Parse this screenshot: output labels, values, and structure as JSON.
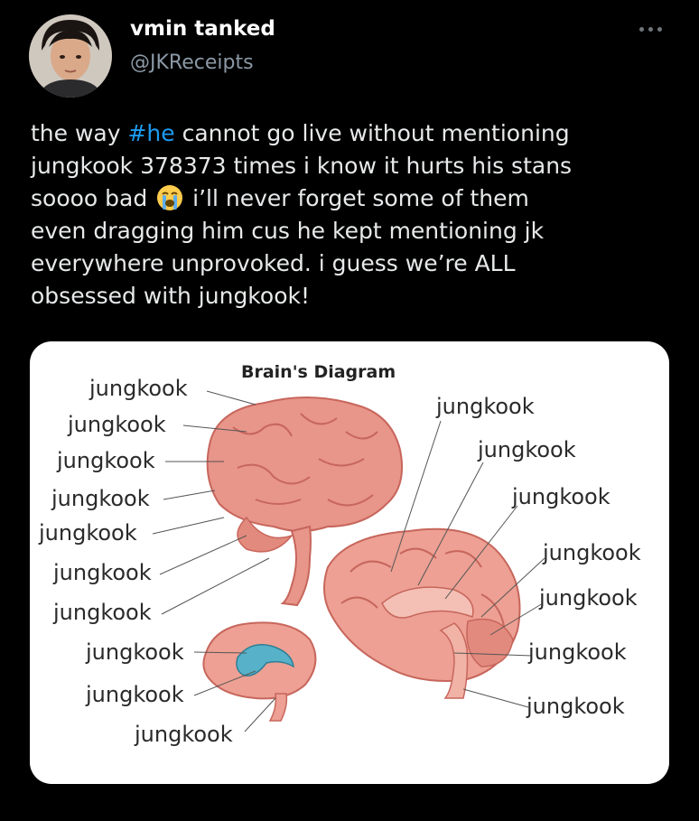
{
  "author": {
    "display_name": "vmin tanked",
    "handle": "@JKReceipts"
  },
  "tweet": {
    "line1_pre": "the way ",
    "hashtag": "#he",
    "line1_post": " cannot go live without mentioning",
    "line2": "jungkook 378373 times i know it hurts his stans",
    "line3_pre": "soooo bad ",
    "line3_post": " i’ll never forget some of them",
    "line4": "even dragging him cus he kept mentioning jk",
    "line5": "everywhere unprovoked. i guess we’re ALL",
    "line6": "obsessed with jungkook!"
  },
  "media": {
    "title": "Brain's Diagram",
    "labels_left": [
      "jungkook",
      "jungkook",
      "jungkook",
      "jungkook",
      "jungkook",
      "jungkook",
      "jungkook"
    ],
    "labels_bottom": [
      "jungkook",
      "jungkook",
      "jungkook"
    ],
    "labels_right": [
      "jungkook",
      "jungkook",
      "jungkook",
      "jungkook",
      "jungkook",
      "jungkook",
      "jungkook"
    ]
  },
  "icons": {
    "more": "more-options-icon",
    "emoji": "loudly-crying-face-icon"
  },
  "colors": {
    "background": "#000000",
    "hashtag": "#1d9bf0",
    "brain": "#e8958a"
  }
}
